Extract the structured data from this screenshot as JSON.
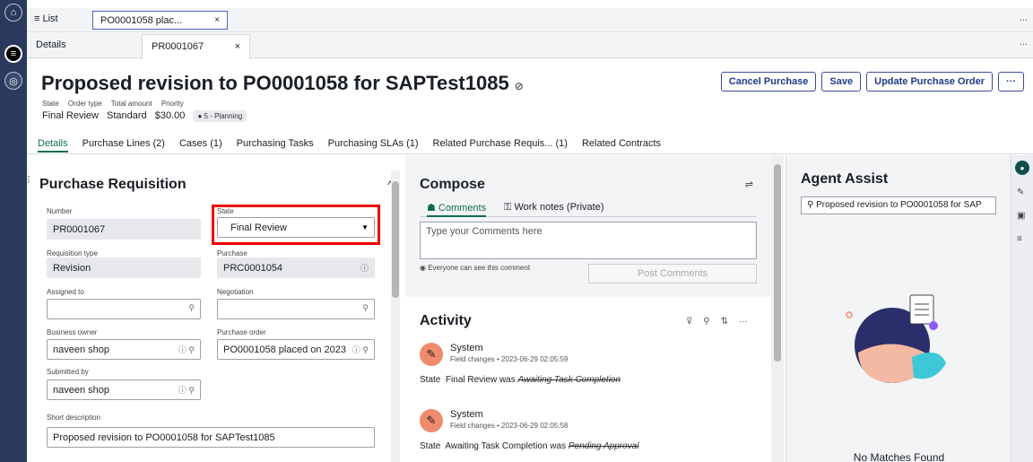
{
  "tabs_primary": {
    "list_label": "≡ List",
    "record_tab": "PO0001058 plac...",
    "close": "×",
    "more": "..."
  },
  "tabs_secondary": {
    "details": "Details",
    "record": "PR0001067",
    "close": "×",
    "more": "..."
  },
  "header": {
    "title": "Proposed revision to PO0001058 for SAPTest1085",
    "tag_icon": "⊘",
    "meta_labels": [
      "State",
      "Order type",
      "Total amount",
      "Priority"
    ],
    "meta_values": [
      "Final Review",
      "Standard",
      "$30.00"
    ],
    "priority_badge": "● 5 - Planning",
    "buttons": {
      "cancel": "Cancel Purchase",
      "save": "Save",
      "update": "Update Purchase Order",
      "more": "···"
    },
    "subtabs": [
      "Details",
      "Purchase Lines (2)",
      "Cases (1)",
      "Purchasing Tasks",
      "Purchasing SLAs (1)",
      "Related Purchase Requis... (1)",
      "Related Contracts"
    ]
  },
  "form": {
    "section_title": "Purchase Requisition",
    "collapse_icon": "^",
    "fields": {
      "number": {
        "label": "Number",
        "value": "PR0001067"
      },
      "state": {
        "label": "State",
        "value": "Final Review"
      },
      "requisition_type": {
        "label": "Requisition type",
        "value": "Revision"
      },
      "purchase": {
        "label": "Purchase",
        "value": "PRC0001054"
      },
      "assigned_to": {
        "label": "Assigned to",
        "value": ""
      },
      "negotiation": {
        "label": "Negotiation",
        "value": ""
      },
      "business_owner": {
        "label": "Business owner",
        "value": "naveen shop"
      },
      "purchase_order": {
        "label": "Purchase order",
        "value": "PO0001058 placed on 2023"
      },
      "submitted_by": {
        "label": "Submitted by",
        "value": "naveen shop"
      },
      "short_description": {
        "label": "Short description",
        "value": "Proposed revision to PO0001058 for SAPTest1085"
      }
    }
  },
  "compose": {
    "title": "Compose",
    "tab_comments": "Comments",
    "tab_worknotes": "Work notes (Private)",
    "placeholder": "Type your Comments here",
    "note": "Everyone can see this comment",
    "post_button": "Post Comments"
  },
  "activity": {
    "title": "Activity",
    "entries": [
      {
        "author": "System",
        "sub": "Field changes • 2023-06-29 02:05:59",
        "field": "State",
        "new": "Final Review",
        "was": "was",
        "old": "Awaiting Task Completion"
      },
      {
        "author": "System",
        "sub": "Field changes • 2023-06-29 02:05:58",
        "field": "State",
        "new": "Awaiting Task Completion",
        "was": "was",
        "old": "Pending Approval"
      }
    ]
  },
  "agent_assist": {
    "title": "Agent Assist",
    "search_value": "Proposed revision to PO0001058 for SAP",
    "no_matches": "No Matches Found"
  }
}
